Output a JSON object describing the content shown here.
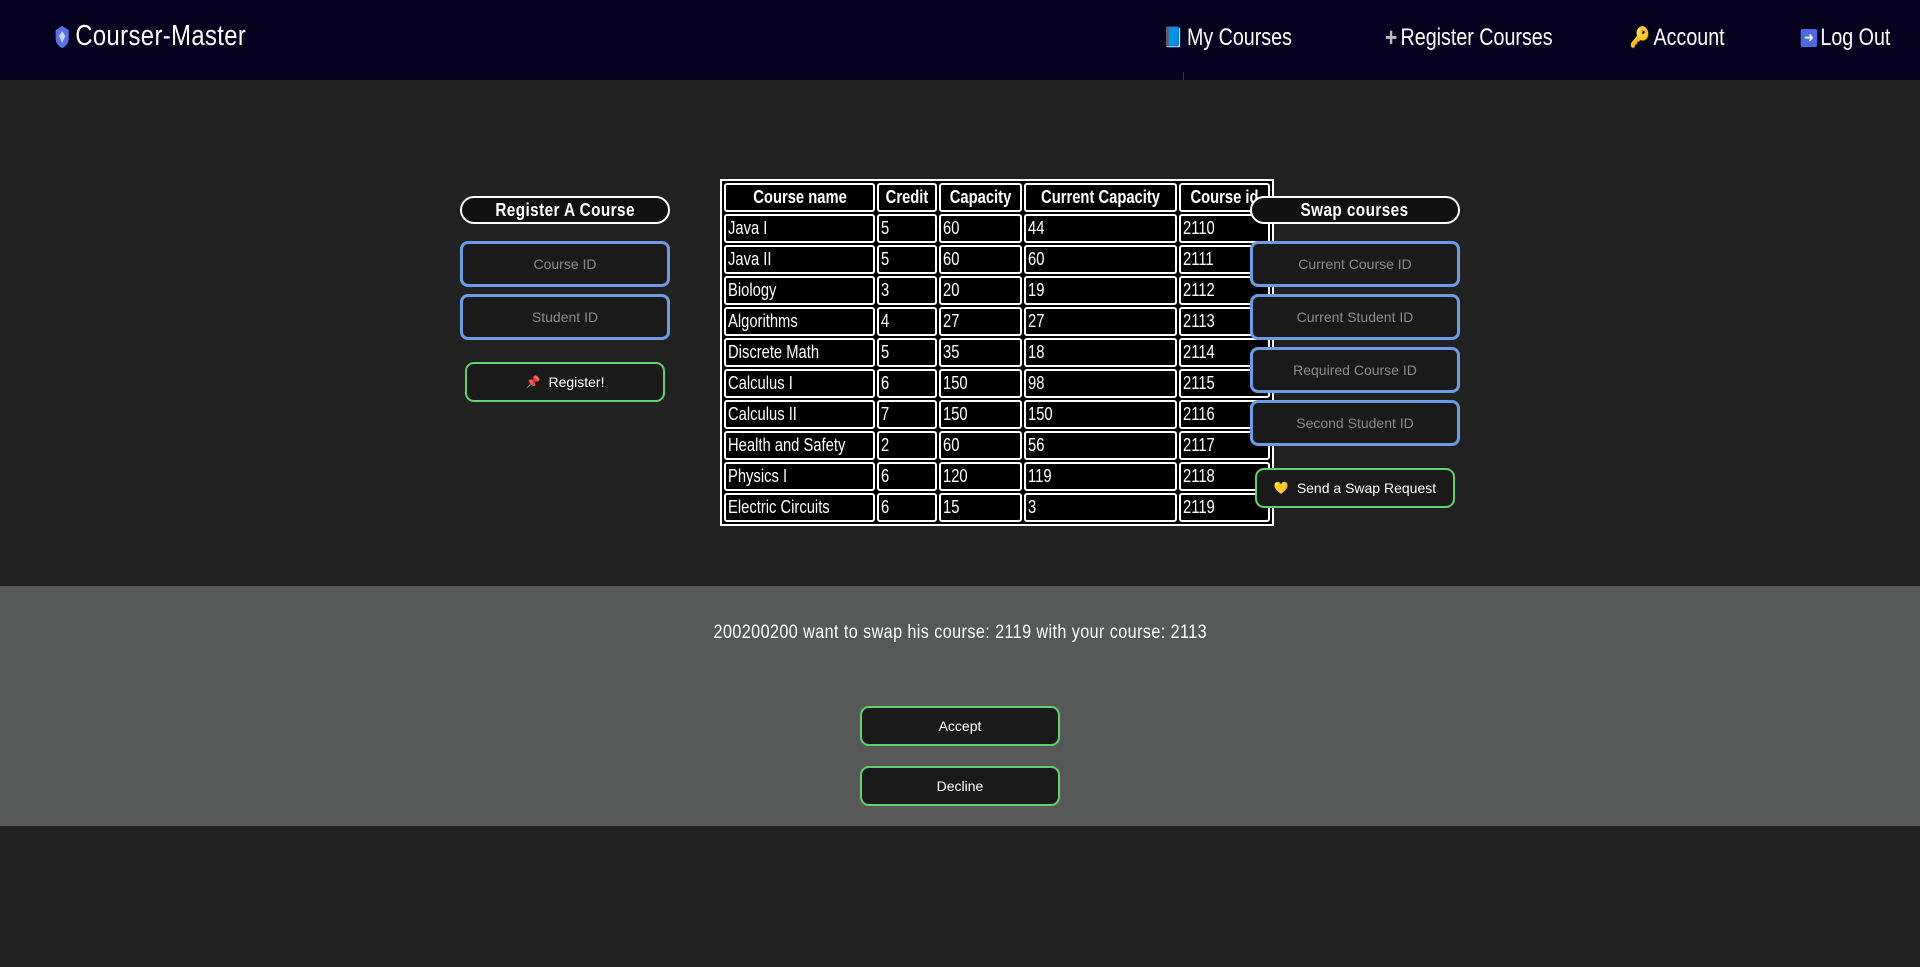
{
  "brand": {
    "name": "Courser-Master",
    "icon": "shield-gem-icon"
  },
  "nav": [
    {
      "label": "My Courses",
      "icon": "book-icon",
      "glyph": "📘"
    },
    {
      "label": "Register Courses",
      "icon": "plus-icon",
      "glyph": "➕"
    },
    {
      "label": "Account",
      "icon": "key-icon",
      "glyph": "🔑"
    },
    {
      "label": "Log Out",
      "icon": "arrow-right-icon",
      "glyph": "➡️"
    }
  ],
  "register": {
    "title": "Register A Course",
    "course_id_placeholder": "Course ID",
    "student_id_placeholder": "Student ID",
    "button_label": "Register!",
    "button_icon": "pushpin-icon",
    "button_glyph": "📌"
  },
  "table": {
    "headers": [
      "Course name",
      "Credit",
      "Capacity",
      "Current Capacity",
      "Course id"
    ],
    "rows": [
      [
        "Java I",
        "5",
        "60",
        "44",
        "2110"
      ],
      [
        "Java II",
        "5",
        "60",
        "60",
        "2111"
      ],
      [
        "Biology",
        "3",
        "20",
        "19",
        "2112"
      ],
      [
        "Algorithms",
        "4",
        "27",
        "27",
        "2113"
      ],
      [
        "Discrete Math",
        "5",
        "35",
        "18",
        "2114"
      ],
      [
        "Calculus I",
        "6",
        "150",
        "98",
        "2115"
      ],
      [
        "Calculus II",
        "7",
        "150",
        "150",
        "2116"
      ],
      [
        "Health and Safety",
        "2",
        "60",
        "56",
        "2117"
      ],
      [
        "Physics I",
        "6",
        "120",
        "119",
        "2118"
      ],
      [
        "Electric Circuits",
        "6",
        "15",
        "3",
        "2119"
      ]
    ]
  },
  "swap": {
    "title": "Swap courses",
    "current_course_placeholder": "Current Course ID",
    "current_student_placeholder": "Current Student ID",
    "required_course_placeholder": "Required Course ID",
    "second_student_placeholder": "Second Student ID",
    "button_label": "Send a Swap Request",
    "button_icon": "yellow-heart-icon",
    "button_glyph": "💛"
  },
  "notification": {
    "message": "200200200 want to swap his course: 2119 with your course: 2113",
    "accept_label": "Accept",
    "decline_label": "Decline"
  },
  "colors": {
    "navbar": "#05011f",
    "background": "#212121",
    "notification_band": "#575958",
    "input_border": "#6a9de6",
    "button_border": "#5cd46a"
  }
}
